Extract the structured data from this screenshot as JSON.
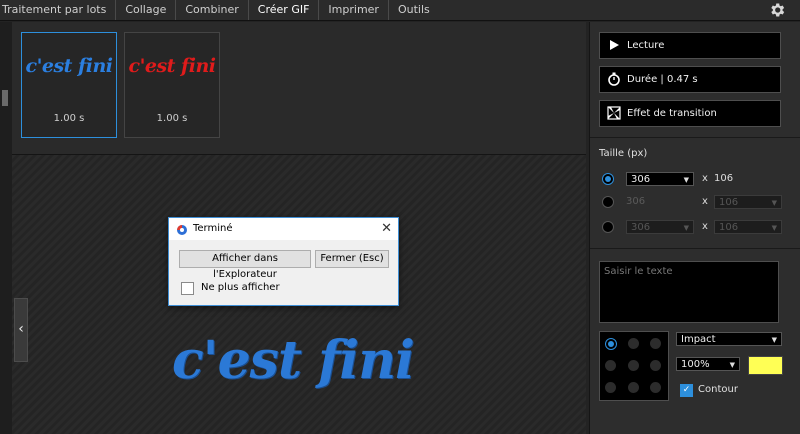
{
  "tabs": [
    {
      "label": "Traitement par lots"
    },
    {
      "label": "Collage"
    },
    {
      "label": "Combiner"
    },
    {
      "label": "Créer GIF"
    },
    {
      "label": "Imprimer"
    },
    {
      "label": "Outils"
    }
  ],
  "active_tab": "Créer GIF",
  "frames": [
    {
      "text": "c'est fini",
      "color": "#2b7fe0",
      "duration": "1.00 s"
    },
    {
      "text": "c'est fini",
      "color": "#e01b1b",
      "duration": "1.00 s"
    }
  ],
  "preview": {
    "text": "c'est fini",
    "color": "#2b79d6"
  },
  "dialog": {
    "title": "Terminé",
    "close": "✕",
    "explorer_button": "Afficher dans l'Explorateur",
    "close_button": "Fermer (Esc)",
    "checkbox_label": "Ne plus afficher"
  },
  "panel": {
    "play_button": "Lecture",
    "duration_button": "Durée | 0.47 s",
    "transition_button": "Effet de transition",
    "size_label": "Taille (px)",
    "size_rows": [
      {
        "width": "306",
        "x": "x",
        "height": "106",
        "selected": true
      },
      {
        "width": "306",
        "x": "x",
        "height": "106",
        "selected": false
      },
      {
        "width": "306",
        "x": "x",
        "height": "106",
        "selected": false
      }
    ],
    "text_placeholder": "Saisir le texte",
    "font": "Impact",
    "zoom": "100%",
    "text_color": "#ffff55",
    "contour_label": "Contour",
    "contour_checked": true
  }
}
